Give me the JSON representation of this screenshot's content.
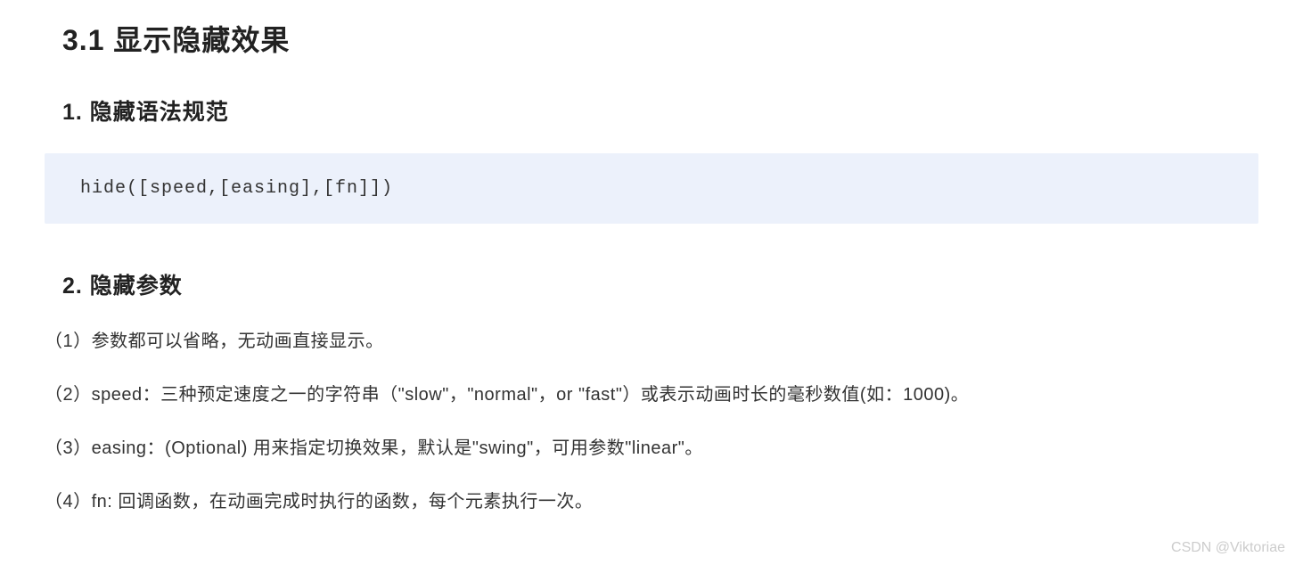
{
  "sectionTitle": "3.1  显示隐藏效果",
  "syntaxTitle": "1. 隐藏语法规范",
  "codeText": "hide([speed,[easing],[fn]])",
  "paramsTitle": "2. 隐藏参数",
  "params": [
    "（1）参数都可以省略，无动画直接显示。",
    "（2）speed：三种预定速度之一的字符串（\"slow\"，\"normal\"，or  \"fast\"）或表示动画时长的毫秒数值(如：1000)。",
    "（3）easing：(Optional) 用来指定切换效果，默认是\"swing\"，可用参数\"linear\"。",
    "（4）fn: 回调函数，在动画完成时执行的函数，每个元素执行一次。"
  ],
  "watermark": "CSDN @Viktoriae"
}
